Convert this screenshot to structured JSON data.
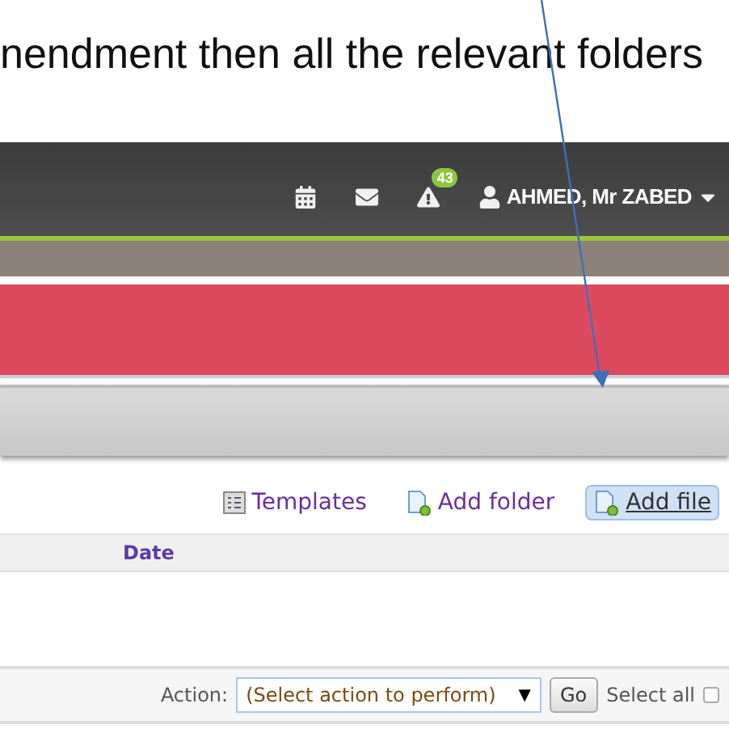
{
  "document_text": "nendment then all the relevant folders",
  "header": {
    "user_name": "AHMED, Mr ZABED",
    "alerts_badge": "43"
  },
  "toolbar": [
    {
      "label": "Templates",
      "kind": "templates",
      "selected": false
    },
    {
      "label": "Add folder",
      "kind": "folder",
      "selected": false
    },
    {
      "label": "Add file",
      "kind": "file",
      "selected": true
    }
  ],
  "table": {
    "columns": [
      "Date"
    ]
  },
  "action_bar": {
    "label": "Action:",
    "select_value": "(Select action to perform)",
    "dropdown_glyph": "▼",
    "go": "Go",
    "select_all": "Select all",
    "select_all_checked": false
  }
}
